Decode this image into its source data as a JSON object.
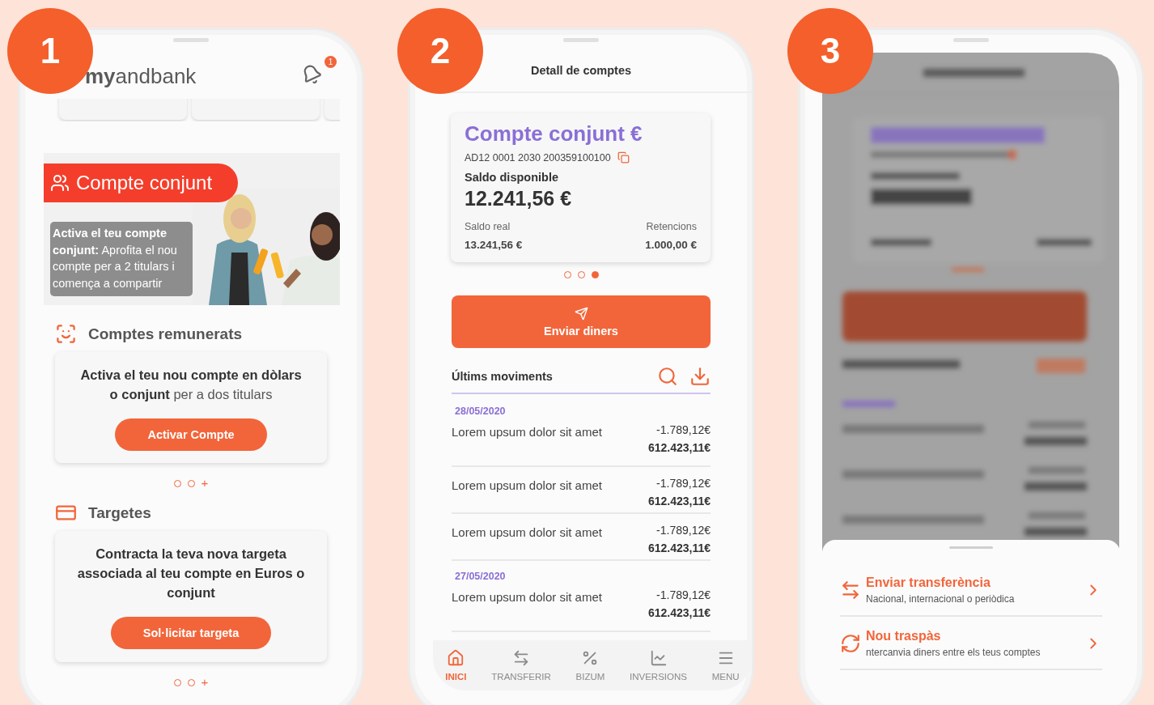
{
  "phones": [
    {
      "kind": "home",
      "step": "1",
      "logo": "**my**andbank",
      "notifications": "1",
      "banner": {
        "title": "Compte conjunt",
        "text": "**Activa el teu compte conjunt:** Aprofita el nou compte per a 2 titulars i comença a compartir"
      },
      "sections": [
        {
          "kind": "accounts",
          "title": "Comptes remunerats",
          "text": "**Activa el teu nou compte en dòlars o conjunt** per a dos titulars",
          "bold": false,
          "button": "Activar Compte",
          "pager": [
            {
              "kind": "dot",
              "selected": false
            },
            {
              "kind": "dot",
              "selected": false
            },
            {
              "kind": "more",
              "label": "+"
            }
          ]
        },
        {
          "kind": "cards",
          "title": "Targetes",
          "text": "Contracta la teva nova targeta associada al teu compte en Euros o conjunt",
          "bold": true,
          "button": "Sol·licitar targeta",
          "pager": [
            {
              "kind": "dot",
              "selected": false
            },
            {
              "kind": "dot",
              "selected": false
            },
            {
              "kind": "more",
              "label": "+"
            }
          ]
        }
      ]
    },
    {
      "kind": "detail",
      "step": "2",
      "title": "Detall de comptes",
      "account": {
        "name": "Compte conjunt €",
        "iban": "AD12 0001 2030 200359100100",
        "available_label": "Saldo disponible",
        "available": "12.241,56 €",
        "real_label": "Saldo real",
        "real": "13.241,56 €",
        "holds_label": "Retencions",
        "holds": "1.000,00 €"
      },
      "pager": [
        {
          "kind": "dot",
          "selected": false
        },
        {
          "kind": "dot",
          "selected": false
        },
        {
          "kind": "dot",
          "selected": true
        }
      ],
      "send_button": "Enviar diners",
      "movements_title": "Últims moviments",
      "groups": [
        {
          "date": "28/05/2020",
          "rows": [
            {
              "concept": "Lorem upsum dolor sit amet",
              "amount": "-1.789,12€",
              "balance": "612.423,11€"
            },
            {
              "concept": "Lorem upsum dolor sit amet",
              "amount": "-1.789,12€",
              "balance": "612.423,11€"
            },
            {
              "concept": "Lorem upsum dolor sit amet",
              "amount": "-1.789,12€",
              "balance": "612.423,11€"
            }
          ]
        },
        {
          "date": "27/05/2020",
          "rows": [
            {
              "concept": "Lorem upsum dolor sit amet",
              "amount": "-1.789,12€",
              "balance": "612.423,11€"
            }
          ]
        }
      ],
      "nav": [
        {
          "kind": "home",
          "label": "INICI",
          "selected": true
        },
        {
          "kind": "transfer",
          "label": "TRANSFERIR",
          "selected": false
        },
        {
          "kind": "bizum",
          "label": "BIZUM",
          "selected": false
        },
        {
          "kind": "invest",
          "label": "INVERSIONS",
          "selected": false
        },
        {
          "kind": "menu",
          "label": "MENU",
          "selected": false
        }
      ]
    },
    {
      "kind": "sheet",
      "step": "3",
      "options": [
        {
          "kind": "transfer",
          "title": "Enviar transferència",
          "subtitle": "Nacional, internacional o periòdica"
        },
        {
          "kind": "swap",
          "title": "Nou traspàs",
          "subtitle": "ntercanvia diners entre els teus comptes"
        }
      ]
    }
  ]
}
